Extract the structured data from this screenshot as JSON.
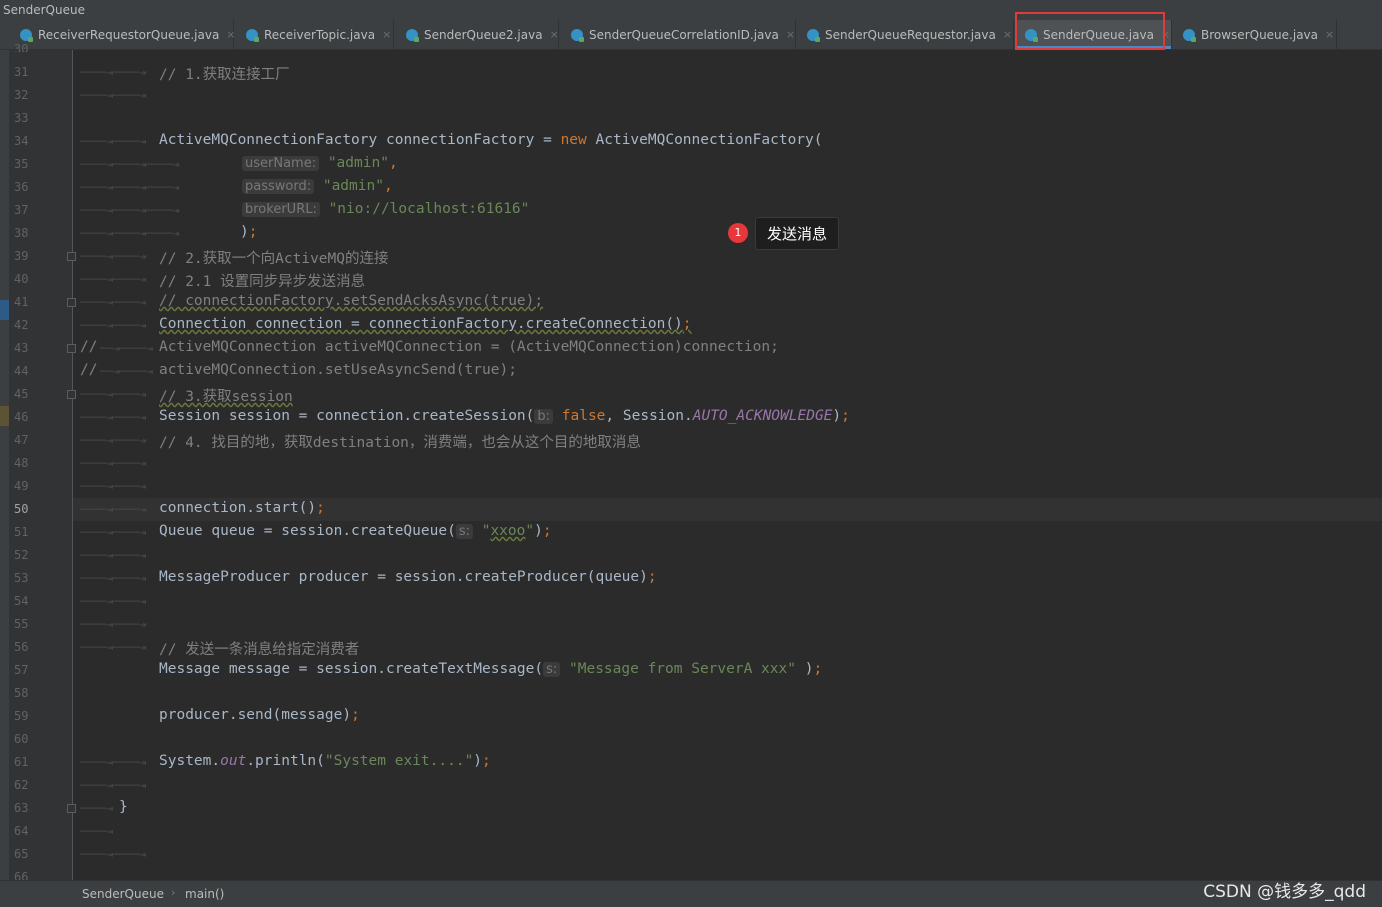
{
  "window": {
    "title": "SenderQueue"
  },
  "tabs": [
    {
      "label": "ReceiverRequestorQueue.java",
      "close": "×"
    },
    {
      "label": "ReceiverTopic.java",
      "close": "×"
    },
    {
      "label": "SenderQueue2.java",
      "close": "×"
    },
    {
      "label": "SenderQueueCorrelationID.java",
      "close": "×"
    },
    {
      "label": "SenderQueueRequestor.java",
      "close": "×"
    },
    {
      "label": "SenderQueue.java",
      "close": "×"
    },
    {
      "label": "BrowserQueue.java",
      "close": "×"
    }
  ],
  "active_tab": "SenderQueue.java",
  "current_line": "50",
  "lines": [
    "30",
    "31",
    "32",
    "33",
    "34",
    "35",
    "36",
    "37",
    "38",
    "39",
    "40",
    "41",
    "42",
    "43",
    "44",
    "45",
    "46",
    "47",
    "48",
    "49",
    "50",
    "51",
    "52",
    "53",
    "54",
    "55",
    "56",
    "57",
    "58",
    "59",
    "60",
    "61",
    "62",
    "63",
    "64",
    "65",
    "66"
  ],
  "code": {
    "l31": "// 1.获取连接工厂",
    "l34_type": "ActiveMQConnectionFactory",
    "l34_var": " connectionFactory = ",
    "l34_new": "new",
    "l34_rest": " ActiveMQConnectionFactory(",
    "l35_hint": "userName:",
    "l35_val": "\"admin\"",
    "l35_end": ",",
    "l36_hint": "password:",
    "l36_val": "\"admin\"",
    "l36_end": ",",
    "l37_hint": "brokerURL:",
    "l37_val": "\"nio://localhost:61616\"",
    "l38": ")",
    "l38_semi": ";",
    "l39": "// 2.获取一个向ActiveMQ的连接",
    "l40": "// 2.1 设置同步异步发送消息",
    "l41": "// connectionFactory.setSendAcksAsync(true);",
    "l42": "Connection connection = connectionFactory.createConnection()",
    "l42_semi": ";",
    "l43_prefix": "//",
    "l43": "ActiveMQConnection activeMQConnection = (ActiveMQConnection)connection;",
    "l44_prefix": "//",
    "l44": "activeMQConnection.setUseAsyncSend(true);",
    "l45": "// 3.获取session",
    "l46_a": "Session session = connection.createSession(",
    "l46_hint": "b:",
    "l46_false": "false",
    "l46_b": ", Session.",
    "l46_const": "AUTO_ACKNOWLEDGE",
    "l46_c": ")",
    "l46_semi": ";",
    "l47": "// 4. 找目的地，获取destination，消费端，也会从这个目的地取消息",
    "l50": "connection.start()",
    "l50_semi": ";",
    "l51_a": "Queue queue = session.createQueue(",
    "l51_hint": "s:",
    "l51_q1": "\"",
    "l51_str": "xxoo",
    "l51_q2": "\"",
    "l51_b": ")",
    "l51_semi": ";",
    "l53": "MessageProducer producer = session.createProducer(queue)",
    "l53_semi": ";",
    "l56": "// 发送一条消息给指定消费者",
    "l57_a": "Message message = session.createTextMessage(",
    "l57_hint": "s:",
    "l57_str": "\"Message from ServerA xxx\"",
    "l57_b": " )",
    "l57_semi": ";",
    "l59": "producer.send(message)",
    "l59_semi": ";",
    "l61_a": "System.",
    "l61_out": "out",
    "l61_b": ".println(",
    "l61_str": "\"System exit....\"",
    "l61_c": ")",
    "l61_semi": ";",
    "l63": "}"
  },
  "annotation": {
    "badge": "1",
    "tooltip": "发送消息"
  },
  "breadcrumb": {
    "class": "SenderQueue",
    "method": "main()",
    "sep": "›"
  },
  "watermark": "CSDN @钱多多_qdd",
  "colors": {
    "keyword": "#cc7832",
    "string": "#6a8759",
    "comment": "#808080",
    "badge": "#e8373a",
    "highlight_box": "#e03a3a"
  }
}
